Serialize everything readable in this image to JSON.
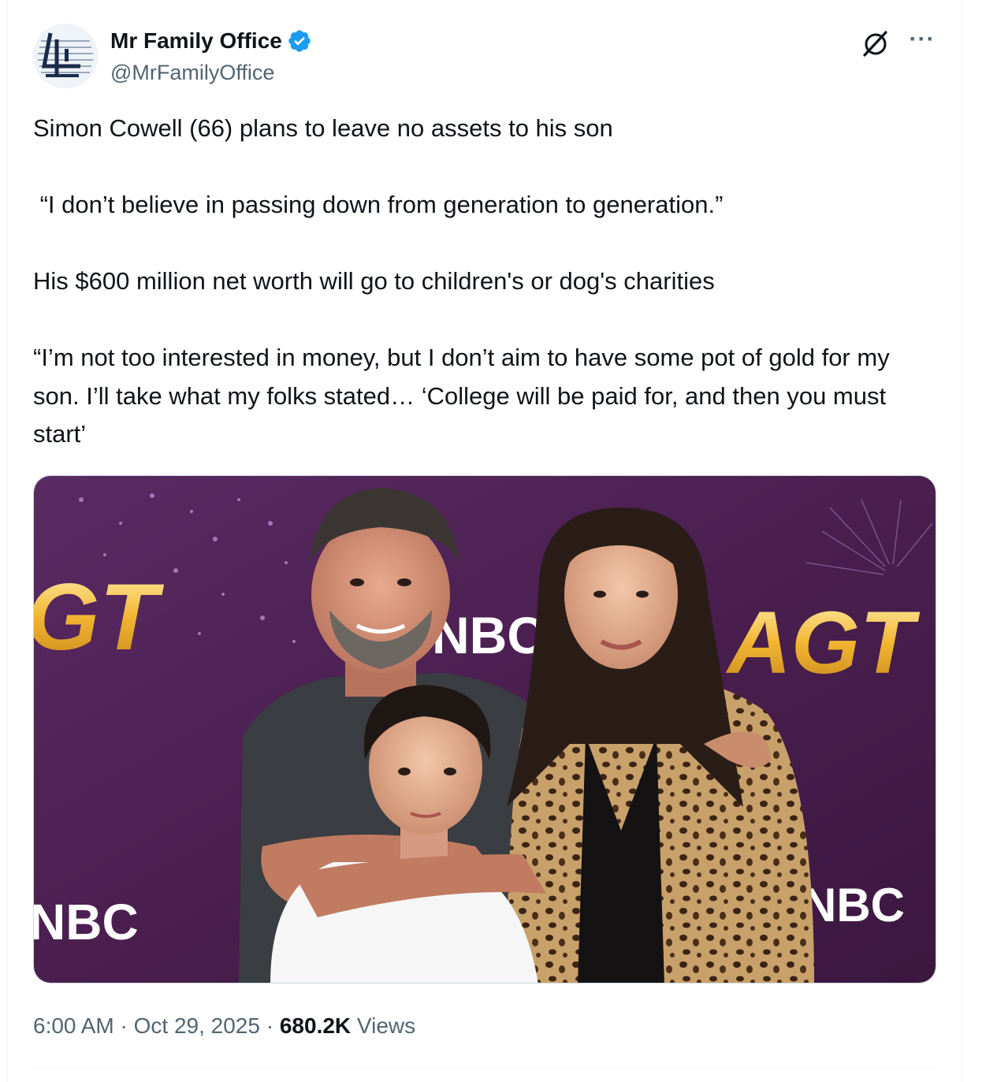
{
  "author": {
    "display_name": "Mr Family Office",
    "handle": "@MrFamilyOffice",
    "verified": true,
    "avatar_icon": "family-office-logo-icon"
  },
  "actions": {
    "grok_icon": "grok-icon",
    "more_icon": "more-options-icon",
    "more_glyph": "···"
  },
  "tweet": {
    "paragraphs": [
      "Simon Cowell (66) plans to leave no assets to his son",
      " “I don’t believe in passing down from generation to generation.”",
      "His $600 million net worth will go to children's or dog's charities",
      "“I’m not too interested in money, but I don’t aim to have some pot of gold for my son. I’ll take what my folks stated… ‘College will be paid for, and then you must start’"
    ]
  },
  "media": {
    "signage": {
      "agt_left": "GT",
      "nbc_top": "NBC",
      "agt_right": "AGT",
      "nbc_bottom_left": "NBC",
      "nbc_bottom_right": "NBC"
    }
  },
  "meta": {
    "time": "6:00 AM",
    "separator": " · ",
    "date": "Oct 29, 2025",
    "views_count": "680.2K",
    "views_label": " Views"
  },
  "colors": {
    "text_primary": "#0f1419",
    "text_secondary": "#536471",
    "verified_blue": "#1d9bf0",
    "backdrop_purple": "#4a1f4f",
    "agt_gold": "#f2b531"
  }
}
